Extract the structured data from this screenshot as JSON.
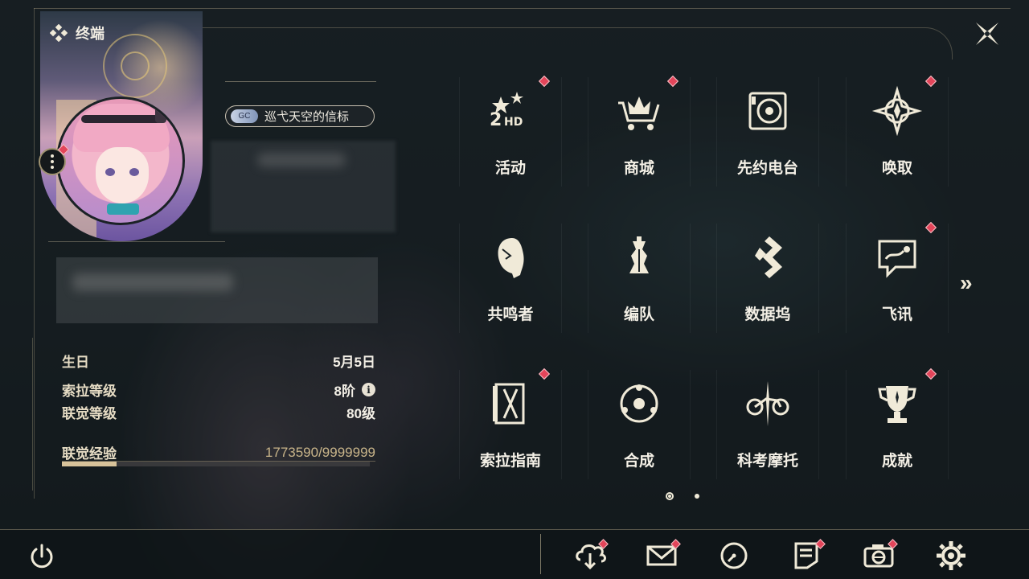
{
  "profile": {
    "title": "终端",
    "badge_label": "巡弋天空的信标",
    "badge_logo_text": "GC"
  },
  "stats": {
    "birthday_label": "生日",
    "birthday_value": "5月5日",
    "sola_level_label": "索拉等级",
    "sola_level_value": "8阶",
    "union_level_label": "联觉等级",
    "union_level_value": "80级",
    "union_exp_label": "联觉经验",
    "union_exp_value": "1773590/9999999",
    "union_exp_progress": 0.177
  },
  "grid": [
    {
      "label": "活动",
      "icon": "event-2hd-icon",
      "badge": true
    },
    {
      "label": "商城",
      "icon": "shop-cart-icon",
      "badge": true
    },
    {
      "label": "先约电台",
      "icon": "radio-icon",
      "badge": false
    },
    {
      "label": "唤取",
      "icon": "convene-compass-icon",
      "badge": true
    },
    {
      "label": "共鸣者",
      "icon": "resonator-head-icon",
      "badge": false
    },
    {
      "label": "编队",
      "icon": "team-chess-icon",
      "badge": false
    },
    {
      "label": "数据坞",
      "icon": "data-dock-icon",
      "badge": false
    },
    {
      "label": "飞讯",
      "icon": "message-bubble-icon",
      "badge": true
    },
    {
      "label": "索拉指南",
      "icon": "guidebook-icon",
      "badge": true
    },
    {
      "label": "合成",
      "icon": "synthesis-icon",
      "badge": false
    },
    {
      "label": "科考摩托",
      "icon": "motorcycle-icon",
      "badge": false
    },
    {
      "label": "成就",
      "icon": "trophy-icon",
      "badge": true
    }
  ],
  "pagination": {
    "current": 1,
    "total": 2
  },
  "bottom_bar": [
    {
      "icon": "download-cloud-icon",
      "badge": true
    },
    {
      "icon": "mail-icon",
      "badge": true
    },
    {
      "icon": "clock-icon",
      "badge": false
    },
    {
      "icon": "notice-icon",
      "badge": true
    },
    {
      "icon": "camera-icon",
      "badge": true
    },
    {
      "icon": "settings-gear-icon",
      "badge": false
    }
  ],
  "colors": {
    "accent_gold": "#d8c39a",
    "badge_red": "#e3455a",
    "text_light": "#f4f0e6"
  }
}
